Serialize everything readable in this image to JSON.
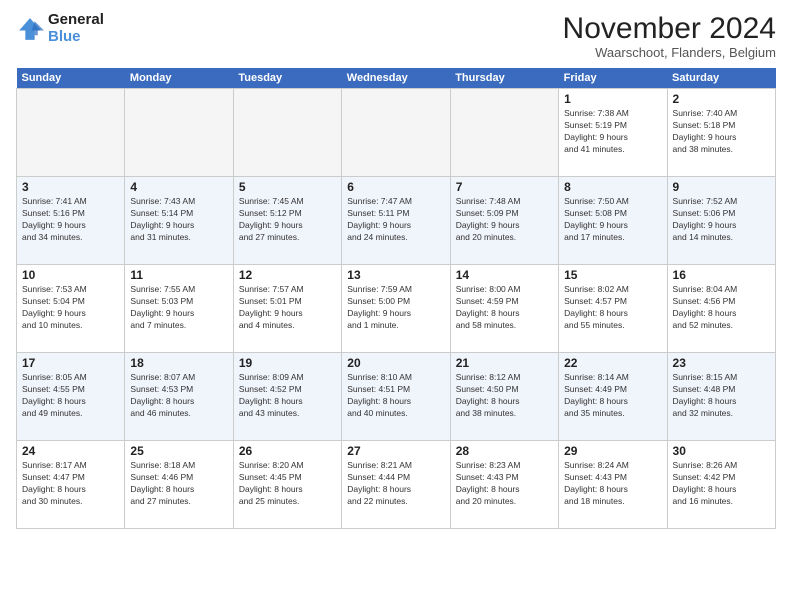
{
  "header": {
    "logo_line1": "General",
    "logo_line2": "Blue",
    "month_title": "November 2024",
    "location": "Waarschoot, Flanders, Belgium"
  },
  "weekdays": [
    "Sunday",
    "Monday",
    "Tuesday",
    "Wednesday",
    "Thursday",
    "Friday",
    "Saturday"
  ],
  "weeks": [
    [
      {
        "day": "",
        "info": ""
      },
      {
        "day": "",
        "info": ""
      },
      {
        "day": "",
        "info": ""
      },
      {
        "day": "",
        "info": ""
      },
      {
        "day": "",
        "info": ""
      },
      {
        "day": "1",
        "info": "Sunrise: 7:38 AM\nSunset: 5:19 PM\nDaylight: 9 hours\nand 41 minutes."
      },
      {
        "day": "2",
        "info": "Sunrise: 7:40 AM\nSunset: 5:18 PM\nDaylight: 9 hours\nand 38 minutes."
      }
    ],
    [
      {
        "day": "3",
        "info": "Sunrise: 7:41 AM\nSunset: 5:16 PM\nDaylight: 9 hours\nand 34 minutes."
      },
      {
        "day": "4",
        "info": "Sunrise: 7:43 AM\nSunset: 5:14 PM\nDaylight: 9 hours\nand 31 minutes."
      },
      {
        "day": "5",
        "info": "Sunrise: 7:45 AM\nSunset: 5:12 PM\nDaylight: 9 hours\nand 27 minutes."
      },
      {
        "day": "6",
        "info": "Sunrise: 7:47 AM\nSunset: 5:11 PM\nDaylight: 9 hours\nand 24 minutes."
      },
      {
        "day": "7",
        "info": "Sunrise: 7:48 AM\nSunset: 5:09 PM\nDaylight: 9 hours\nand 20 minutes."
      },
      {
        "day": "8",
        "info": "Sunrise: 7:50 AM\nSunset: 5:08 PM\nDaylight: 9 hours\nand 17 minutes."
      },
      {
        "day": "9",
        "info": "Sunrise: 7:52 AM\nSunset: 5:06 PM\nDaylight: 9 hours\nand 14 minutes."
      }
    ],
    [
      {
        "day": "10",
        "info": "Sunrise: 7:53 AM\nSunset: 5:04 PM\nDaylight: 9 hours\nand 10 minutes."
      },
      {
        "day": "11",
        "info": "Sunrise: 7:55 AM\nSunset: 5:03 PM\nDaylight: 9 hours\nand 7 minutes."
      },
      {
        "day": "12",
        "info": "Sunrise: 7:57 AM\nSunset: 5:01 PM\nDaylight: 9 hours\nand 4 minutes."
      },
      {
        "day": "13",
        "info": "Sunrise: 7:59 AM\nSunset: 5:00 PM\nDaylight: 9 hours\nand 1 minute."
      },
      {
        "day": "14",
        "info": "Sunrise: 8:00 AM\nSunset: 4:59 PM\nDaylight: 8 hours\nand 58 minutes."
      },
      {
        "day": "15",
        "info": "Sunrise: 8:02 AM\nSunset: 4:57 PM\nDaylight: 8 hours\nand 55 minutes."
      },
      {
        "day": "16",
        "info": "Sunrise: 8:04 AM\nSunset: 4:56 PM\nDaylight: 8 hours\nand 52 minutes."
      }
    ],
    [
      {
        "day": "17",
        "info": "Sunrise: 8:05 AM\nSunset: 4:55 PM\nDaylight: 8 hours\nand 49 minutes."
      },
      {
        "day": "18",
        "info": "Sunrise: 8:07 AM\nSunset: 4:53 PM\nDaylight: 8 hours\nand 46 minutes."
      },
      {
        "day": "19",
        "info": "Sunrise: 8:09 AM\nSunset: 4:52 PM\nDaylight: 8 hours\nand 43 minutes."
      },
      {
        "day": "20",
        "info": "Sunrise: 8:10 AM\nSunset: 4:51 PM\nDaylight: 8 hours\nand 40 minutes."
      },
      {
        "day": "21",
        "info": "Sunrise: 8:12 AM\nSunset: 4:50 PM\nDaylight: 8 hours\nand 38 minutes."
      },
      {
        "day": "22",
        "info": "Sunrise: 8:14 AM\nSunset: 4:49 PM\nDaylight: 8 hours\nand 35 minutes."
      },
      {
        "day": "23",
        "info": "Sunrise: 8:15 AM\nSunset: 4:48 PM\nDaylight: 8 hours\nand 32 minutes."
      }
    ],
    [
      {
        "day": "24",
        "info": "Sunrise: 8:17 AM\nSunset: 4:47 PM\nDaylight: 8 hours\nand 30 minutes."
      },
      {
        "day": "25",
        "info": "Sunrise: 8:18 AM\nSunset: 4:46 PM\nDaylight: 8 hours\nand 27 minutes."
      },
      {
        "day": "26",
        "info": "Sunrise: 8:20 AM\nSunset: 4:45 PM\nDaylight: 8 hours\nand 25 minutes."
      },
      {
        "day": "27",
        "info": "Sunrise: 8:21 AM\nSunset: 4:44 PM\nDaylight: 8 hours\nand 22 minutes."
      },
      {
        "day": "28",
        "info": "Sunrise: 8:23 AM\nSunset: 4:43 PM\nDaylight: 8 hours\nand 20 minutes."
      },
      {
        "day": "29",
        "info": "Sunrise: 8:24 AM\nSunset: 4:43 PM\nDaylight: 8 hours\nand 18 minutes."
      },
      {
        "day": "30",
        "info": "Sunrise: 8:26 AM\nSunset: 4:42 PM\nDaylight: 8 hours\nand 16 minutes."
      }
    ]
  ]
}
